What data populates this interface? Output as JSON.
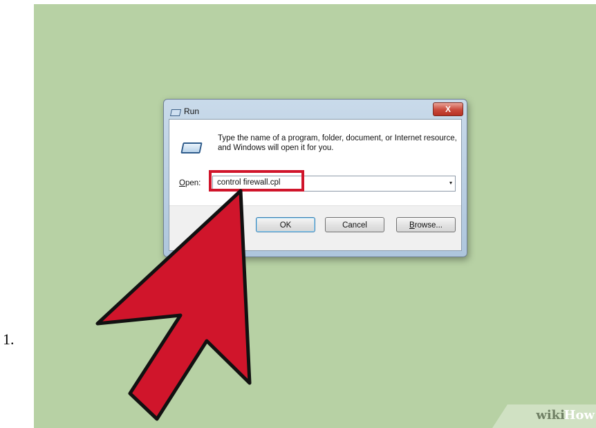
{
  "list": {
    "number": "1."
  },
  "dialog": {
    "title": "Run",
    "close_label": "X",
    "icon": "run-icon",
    "description": "Type the name of a program, folder, document, or Internet resource, and Windows will open it for you.",
    "open_label_accel": "O",
    "open_label_rest": "pen:",
    "open_value": "control firewall.cpl",
    "dropdown_arrow": "▾",
    "buttons": {
      "ok": "OK",
      "cancel": "Cancel",
      "browse_accel": "B",
      "browse_rest": "rowse..."
    }
  },
  "annotation": {
    "arrow_color": "#d0152b",
    "highlight_color": "#d0152b"
  },
  "watermark": {
    "wiki": "wiki",
    "how": "How"
  },
  "colors": {
    "background": "#b7d1a4"
  }
}
